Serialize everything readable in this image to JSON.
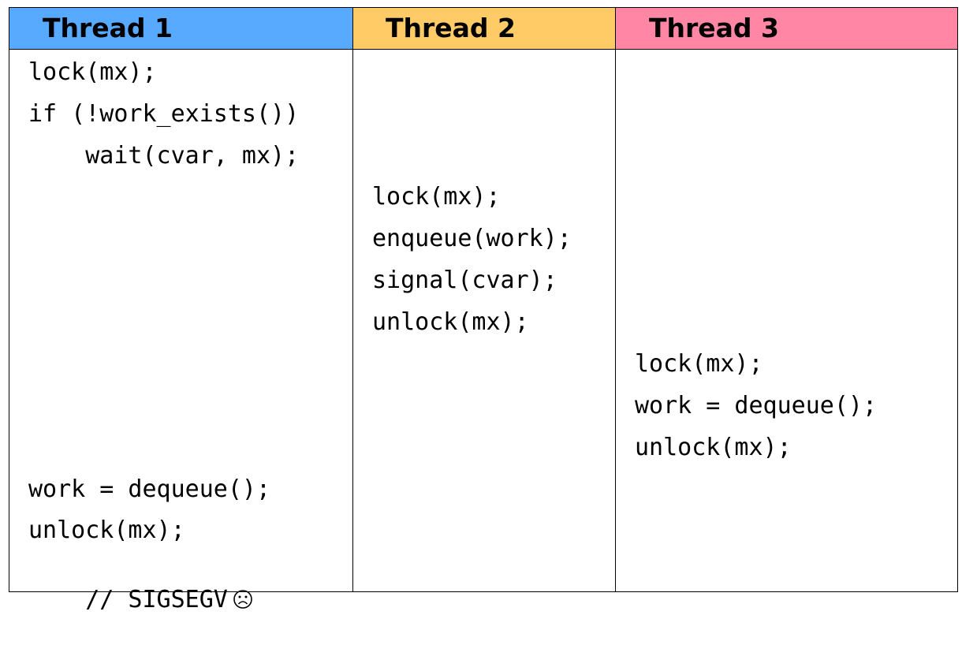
{
  "columns": [
    {
      "title": "Thread 1",
      "color": "#57aaff"
    },
    {
      "title": "Thread 2",
      "color": "#ffcb66"
    },
    {
      "title": "Thread 3",
      "color": "#ff86a5"
    }
  ],
  "thread1": {
    "lines": [
      "lock(mx);",
      "if (!work_exists())",
      "    wait(cvar, mx);",
      "work = dequeue();",
      "unlock(mx);",
      "// SIGSEGV"
    ],
    "last_icon": "frown-face-icon"
  },
  "thread2": {
    "lines": [
      "lock(mx);",
      "enqueue(work);",
      "signal(cvar);",
      "unlock(mx);"
    ]
  },
  "thread3": {
    "lines": [
      "lock(mx);",
      "work = dequeue();",
      "unlock(mx);"
    ]
  }
}
